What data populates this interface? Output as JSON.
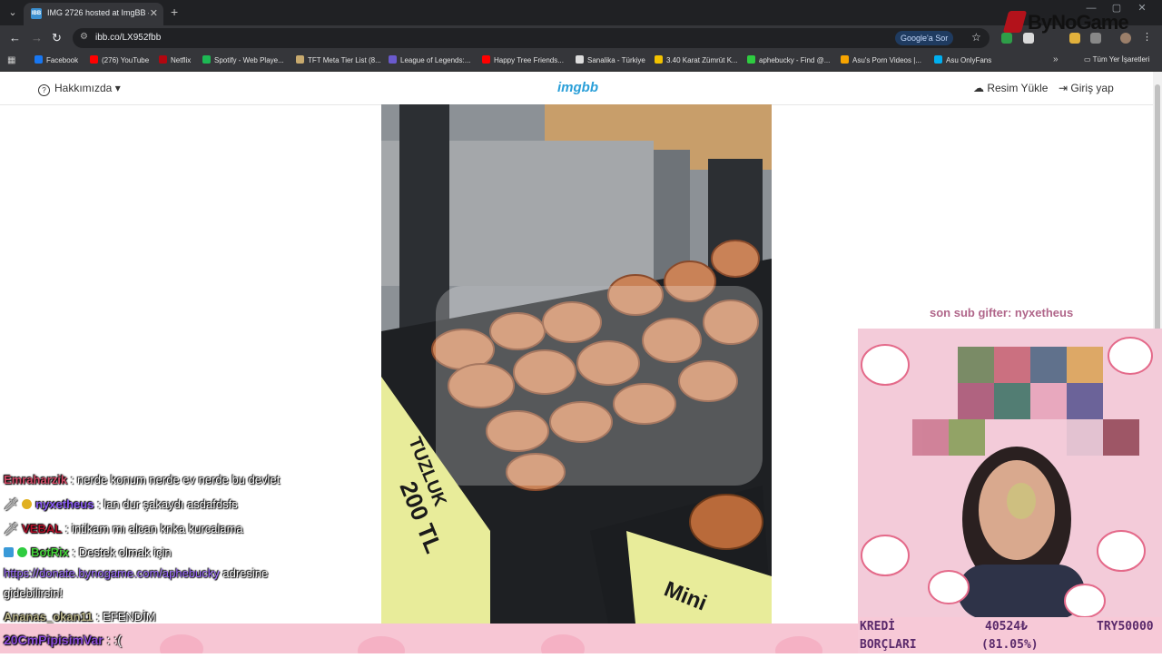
{
  "browser": {
    "tab_title": "IMG 2726 hosted at ImgBB — I",
    "favicon_text": "IBB",
    "url": "ibb.co/LX952fbb",
    "google_ask": "Google'a Sor",
    "bookmarks": [
      {
        "label": "Facebook",
        "color": "#1877f2"
      },
      {
        "label": "(276) YouTube",
        "color": "#ff0000"
      },
      {
        "label": "Netflix",
        "color": "#b20710"
      },
      {
        "label": "Spotify - Web Playe...",
        "color": "#1db954"
      },
      {
        "label": "TFT Meta Tier List (8...",
        "color": "#c8aa6e"
      },
      {
        "label": "League of Legends:...",
        "color": "#6a5acd"
      },
      {
        "label": "Happy Tree Friends...",
        "color": "#ff0000"
      },
      {
        "label": "Sanalika - Türkiye",
        "color": "#dddddd"
      },
      {
        "label": "3.40 Karat Zümrüt K...",
        "color": "#f2c200"
      },
      {
        "label": "aphebucky - Find @...",
        "color": "#2ecc40"
      },
      {
        "label": "Asu's Porn Videos |...",
        "color": "#f7a400"
      },
      {
        "label": "Asu OnlyFans",
        "color": "#00aff0"
      }
    ],
    "all_bookmarks": "Tüm Yer İşaretleri"
  },
  "site": {
    "about": "Hakkımızda",
    "logo": "imgbb",
    "upload": "Resim Yükle",
    "login": "Giriş yap"
  },
  "photo": {
    "sign1_line1": "TUZLUK",
    "sign1_line2": "200 TL",
    "sign2": "Mini"
  },
  "stream": {
    "brand": "ByNoGame",
    "sub_gifter": "son sub gifter: nyxetheus",
    "chat": [
      {
        "user": "Emraharzik",
        "message": ": nerde konum nerde ev nerde bu devlet",
        "color": "#d24a66"
      },
      {
        "user": "nyxetheus",
        "message": ": lan dur şakaydı asdafdsfs",
        "color": "#8a5cf5"
      },
      {
        "user": "VEBAL",
        "message": ": intikam mı alcan knka kurcalama",
        "color": "#b0102a"
      },
      {
        "user": "BotRix",
        "message": ": Destek olmak için",
        "color": "#45d13a"
      },
      {
        "link": "https://donate.bynogame.com/aphebucky",
        "message": " adresine"
      },
      {
        "message": "gidebilirsin!"
      },
      {
        "user": "Ananas_okan11",
        "message": ": EFENDİM",
        "color": "#b9b48a"
      },
      {
        "user": "20CmPipisimVar",
        "message": ": :(",
        "color": "#8a4ad5"
      }
    ],
    "credit": {
      "label1": "KREDİ",
      "value1": "40524₺",
      "goal": "TRY50000",
      "label2": "BORÇLARI",
      "value2": "(81.05%)"
    }
  }
}
